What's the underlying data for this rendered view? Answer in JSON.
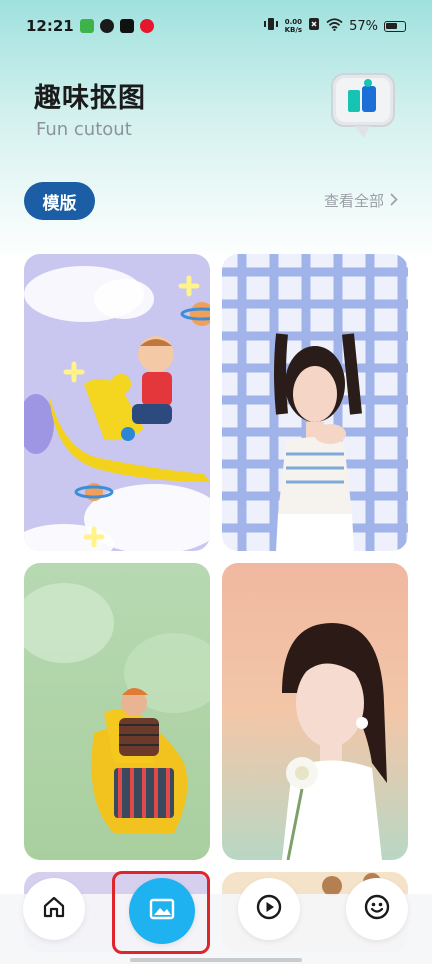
{
  "status_bar": {
    "time": "12:21",
    "net_speed_value": "0.00",
    "net_speed_unit": "KB/s",
    "battery": "57%"
  },
  "header": {
    "title": "趣味抠图",
    "subtitle": "Fun cutout"
  },
  "section": {
    "tag_label": "模版",
    "view_all_label": "查看全部"
  },
  "templates": [
    {
      "name": "baby-on-rocking-horse"
    },
    {
      "name": "girl-with-braids-plaid"
    },
    {
      "name": "woman-yellow-chair"
    },
    {
      "name": "woman-with-flower"
    }
  ],
  "bottom_nav": {
    "items": [
      {
        "icon": "home-icon"
      },
      {
        "icon": "image-icon",
        "selected": true
      },
      {
        "icon": "play-icon"
      },
      {
        "icon": "emoji-icon"
      }
    ]
  },
  "colors": {
    "accent": "#1fb2f0",
    "tag": "#1b5ea6",
    "highlight": "#e0242c"
  }
}
